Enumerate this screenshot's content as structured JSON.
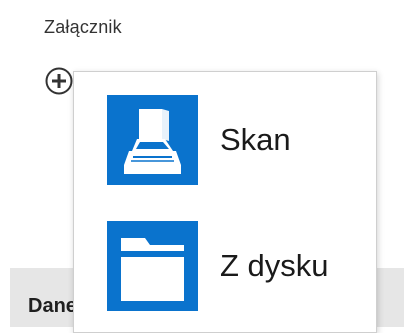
{
  "attachment": {
    "label": "Załącznik",
    "add_icon": "plus-circle-icon"
  },
  "menu": {
    "items": [
      {
        "label": "Skan",
        "icon": "scanner-icon",
        "tile_color": "#0a73cd"
      },
      {
        "label": "Z dysku",
        "icon": "folder-icon",
        "tile_color": "#0a73cd"
      }
    ]
  },
  "section": {
    "label": "Dane"
  }
}
